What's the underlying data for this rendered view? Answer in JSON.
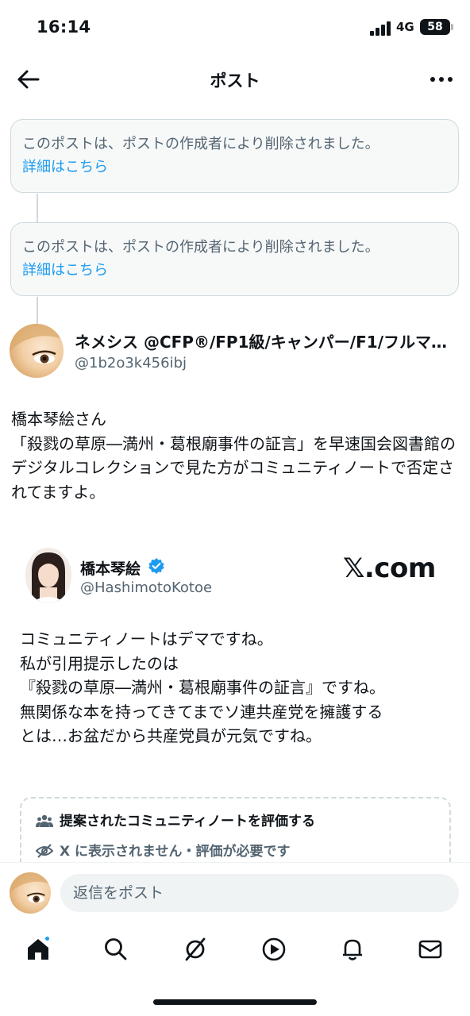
{
  "status_bar": {
    "time": "16:14",
    "network": "4G",
    "battery": "58"
  },
  "header": {
    "title": "ポスト"
  },
  "deleted_posts": [
    {
      "text": "このポストは、ポストの作成者により削除されました。",
      "link": "詳細はこちら"
    },
    {
      "text": "このポストは、ポストの作成者により削除されました。",
      "link": "詳細はこちら"
    }
  ],
  "post": {
    "author_name": "ネメシス @CFP®/FP1級/キャンパー/F1/フルマ…",
    "author_handle": "@1b2o3k456ibj",
    "body": "橋本琴絵さん\n「殺戮の草原―満州・葛根廟事件の証言」を早速国会図書館のデジタルコレクションで見た方がコミュニティノートで否定されてますよ。"
  },
  "embedded": {
    "name": "橋本琴絵",
    "handle": "@HashimotoKotoe",
    "brand": "𝕏.com",
    "body": "コミュニティノートはデマですね。\n私が引用提示したのは\n『殺戮の草原―満州・葛根廟事件の証言』ですね。\n無関係な本を持ってきてまでソ連共産党を擁護する\nとは…お盆だから共産党員が元気ですね。",
    "notes_title": "提案されたコミュニティノートを評価する",
    "notes_status": "X に表示されません・評価が必要です"
  },
  "reply": {
    "placeholder": "返信をポスト"
  },
  "tabs": [
    "home-icon",
    "search-icon",
    "grok-icon",
    "video-icon",
    "notifications-icon",
    "messages-icon"
  ],
  "colors": {
    "accent": "#1d9bf0",
    "text": "#0f1419",
    "secondary": "#536471",
    "border": "#cfd9de"
  }
}
